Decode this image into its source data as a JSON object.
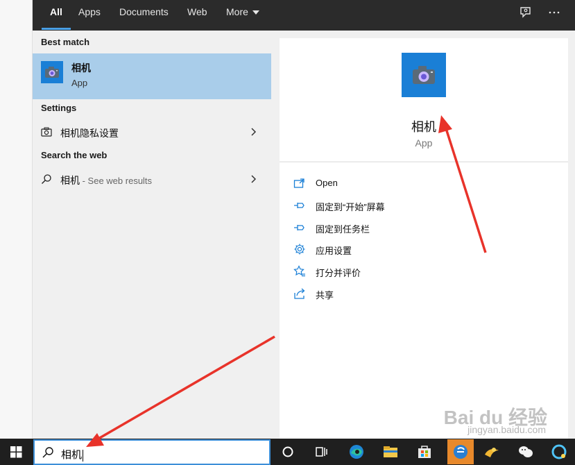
{
  "tabs": [
    {
      "label": "All",
      "active": true
    },
    {
      "label": "Apps",
      "active": false
    },
    {
      "label": "Documents",
      "active": false
    },
    {
      "label": "Web",
      "active": false
    },
    {
      "label": "More",
      "active": false
    }
  ],
  "left": {
    "best_match_heading": "Best match",
    "best_match": {
      "title": "相机",
      "subtitle": "App",
      "icon": "camera-icon"
    },
    "settings_heading": "Settings",
    "settings_item": {
      "label": "相机隐私设置",
      "icon": "camera-outline-icon"
    },
    "web_heading": "Search the web",
    "web_item": {
      "label": "相机",
      "hint": " - See web results",
      "icon": "search-icon"
    }
  },
  "right": {
    "app_name": "相机",
    "app_type": "App",
    "actions": [
      {
        "label": "Open",
        "icon": "open-window-icon"
      },
      {
        "label": "固定到“开始”屏幕",
        "icon": "pin-icon"
      },
      {
        "label": "固定到任务栏",
        "icon": "pin-icon"
      },
      {
        "label": "应用设置",
        "icon": "gear-icon"
      },
      {
        "label": "打分并评价",
        "icon": "star-rate-icon"
      },
      {
        "label": "共享",
        "icon": "share-icon"
      }
    ]
  },
  "search": {
    "query": "相机"
  },
  "watermark": {
    "brand": "Bai du 经验",
    "url": "jingyan.baidu.com"
  },
  "colors": {
    "accent": "#1a7fd6",
    "selected": "#a9cdea",
    "header": "#2b2b2b",
    "annotation": "#e8332a"
  }
}
